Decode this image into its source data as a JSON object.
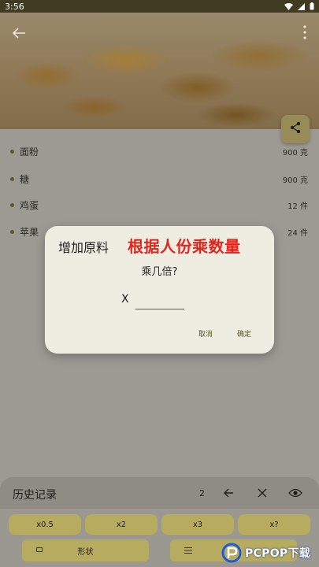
{
  "status_bar": {
    "time": "3:56"
  },
  "colors": {
    "accent": "#b7ab5f",
    "dialog_bg": "#efece2",
    "annotation": "#e0271f",
    "status_bar": "#403c22"
  },
  "ingredients": [
    {
      "name": "面粉",
      "quantity": "900 克"
    },
    {
      "name": "糖",
      "quantity": "900 克"
    },
    {
      "name": "鸡蛋",
      "quantity": "12 件"
    },
    {
      "name": "苹果",
      "quantity": "24 件"
    }
  ],
  "dialog": {
    "title": "增加原料",
    "annotation": "根据人份乘数量",
    "question": "乘几倍?",
    "x_label": "X",
    "input_value": "",
    "cancel_label": "取消",
    "ok_label": "确定"
  },
  "history_panel": {
    "title": "历史记录",
    "count": "2",
    "icons": [
      "back-arrow-icon",
      "close-icon",
      "eye-icon"
    ],
    "multipliers": [
      "x0.5",
      "x2",
      "x3",
      "x?"
    ],
    "shape_label": "形状"
  },
  "watermark": {
    "text": "PCPOP下载"
  }
}
